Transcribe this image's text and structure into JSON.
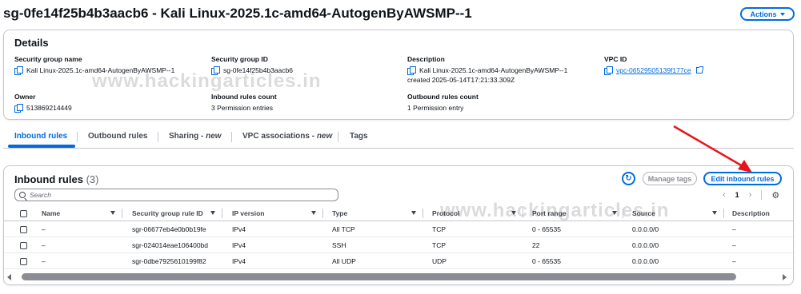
{
  "header": {
    "title": "sg-0fe14f25b4b3aacb6 - Kali Linux-2025.1c-amd64-AutogenByAWSMP--1",
    "actions_label": "Actions"
  },
  "details": {
    "heading": "Details",
    "security_group_name": {
      "label": "Security group name",
      "value": "Kali Linux-2025.1c-amd64-AutogenByAWSMP--1"
    },
    "security_group_id": {
      "label": "Security group ID",
      "value": "sg-0fe14f25b4b3aacb6"
    },
    "description": {
      "label": "Description",
      "value": "Kali Linux-2025.1c-amd64-AutogenByAWSMP--1",
      "value2": "created 2025-05-14T17:21:33.309Z"
    },
    "vpc_id": {
      "label": "VPC ID",
      "value": "vpc-06529505139f177ce"
    },
    "owner": {
      "label": "Owner",
      "value": "513869214449"
    },
    "inbound_rules_count": {
      "label": "Inbound rules count",
      "value": "3 Permission entries"
    },
    "outbound_rules_count": {
      "label": "Outbound rules count",
      "value": "1 Permission entry"
    }
  },
  "watermark": {
    "text": "www.hackingarticles.in"
  },
  "tabs": [
    {
      "label": "Inbound rules",
      "suffix": ""
    },
    {
      "label": "Outbound rules",
      "suffix": ""
    },
    {
      "label": "Sharing - ",
      "suffix": "new"
    },
    {
      "label": "VPC associations - ",
      "suffix": "new"
    },
    {
      "label": "Tags",
      "suffix": ""
    }
  ],
  "inbound": {
    "title": "Inbound rules",
    "count": "(3)",
    "manage_tags_label": "Manage tags",
    "edit_label": "Edit inbound rules",
    "search_placeholder": "Search",
    "page": "1",
    "columns": [
      "Name",
      "Security group rule ID",
      "IP version",
      "Type",
      "Protocol",
      "Port range",
      "Source",
      "Description"
    ],
    "rows": [
      {
        "name": "–",
        "rule_id": "sgr-06677eb4e0b0b19fe",
        "ip_version": "IPv4",
        "type": "All TCP",
        "protocol": "TCP",
        "port_range": "0 - 65535",
        "source": "0.0.0.0/0",
        "description": "–"
      },
      {
        "name": "–",
        "rule_id": "sgr-024014eae106400bd",
        "ip_version": "IPv4",
        "type": "SSH",
        "protocol": "TCP",
        "port_range": "22",
        "source": "0.0.0.0/0",
        "description": "–"
      },
      {
        "name": "–",
        "rule_id": "sgr-0dbe7925610199f82",
        "ip_version": "IPv4",
        "type": "All UDP",
        "protocol": "UDP",
        "port_range": "0 - 65535",
        "source": "0.0.0.0/0",
        "description": "–"
      }
    ]
  },
  "colors": {
    "accent": "#006ce0",
    "annotation_arrow": "#e8141a",
    "border": "#c6c6cd"
  },
  "icons": [
    "copy-icon",
    "external-link-icon",
    "refresh-icon",
    "search-icon",
    "settings-icon",
    "sort-icon",
    "chevron-left-icon",
    "chevron-right-icon",
    "caret-down-icon"
  ]
}
